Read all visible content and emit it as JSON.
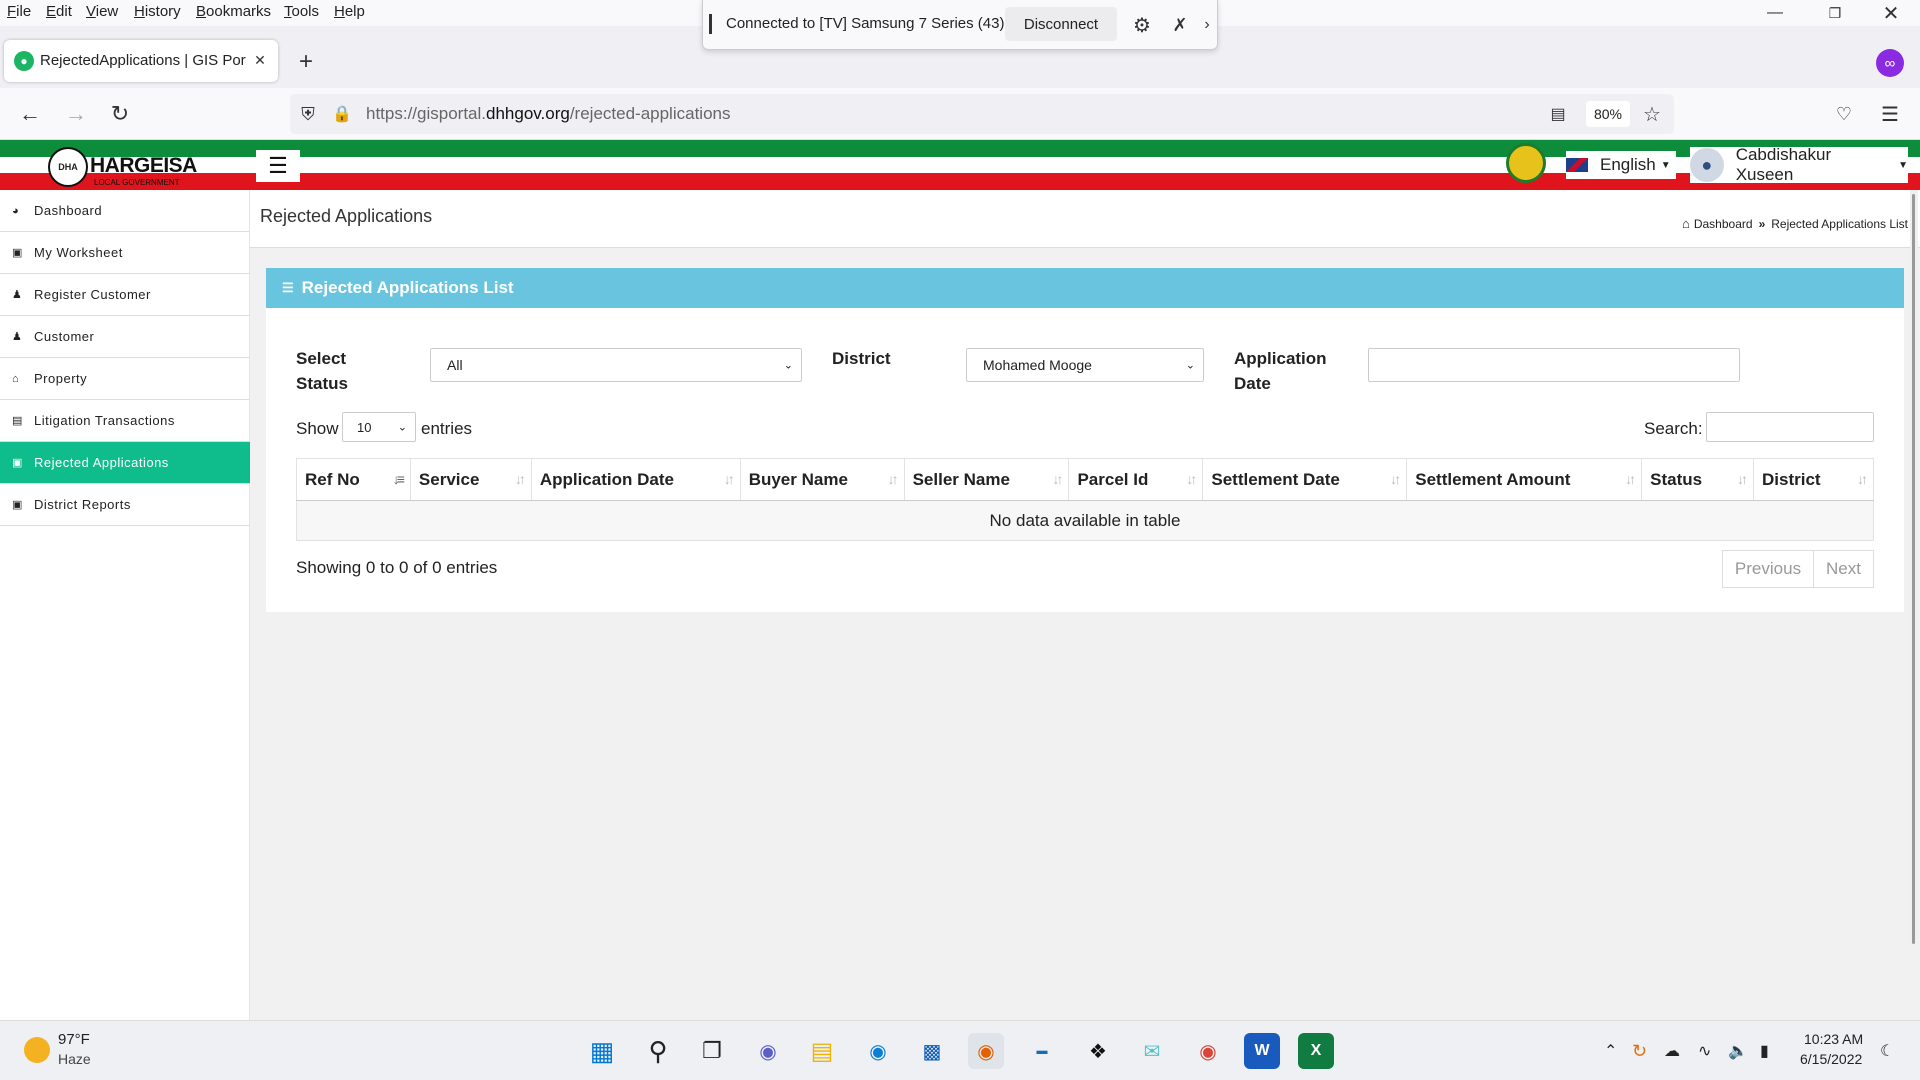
{
  "menubar": {
    "items": [
      "File",
      "Edit",
      "View",
      "History",
      "Bookmarks",
      "Tools",
      "Help"
    ]
  },
  "cast_bar": {
    "status": "Connected to [TV] Samsung 7 Series (43)",
    "disconnect_label": "Disconnect"
  },
  "browser_tab": {
    "title": "RejectedApplications | GIS Porta"
  },
  "urlbar": {
    "url_prefix": "https://gisportal.",
    "url_domain": "dhhgov.org",
    "url_path": "/rejected-applications",
    "zoom": "80%"
  },
  "app_header": {
    "logo_text": "HARGEISA",
    "logo_sub": "LOCAL GOVERNMENT",
    "logo_badge": "DHA",
    "language": "English",
    "user_name": "Cabdishakur Xuseen"
  },
  "sidebar": {
    "items": [
      {
        "label": "Dashboard",
        "icon": "dashboard-icon"
      },
      {
        "label": "My Worksheet",
        "icon": "book-icon"
      },
      {
        "label": "Register Customer",
        "icon": "user-icon"
      },
      {
        "label": "Customer",
        "icon": "user-icon"
      },
      {
        "label": "Property",
        "icon": "home-icon"
      },
      {
        "label": "Litigation Transactions",
        "icon": "credit-card-icon"
      },
      {
        "label": "Rejected Applications",
        "icon": "book-icon"
      },
      {
        "label": "District Reports",
        "icon": "book-icon"
      }
    ],
    "active_index": 6
  },
  "page": {
    "title": "Rejected Applications",
    "breadcrumb_home": "Dashboard",
    "breadcrumb_sep": "»",
    "breadcrumb_current": "Rejected Applications List"
  },
  "panel": {
    "heading": "Rejected Applications List",
    "filters": {
      "status_label_1": "Select",
      "status_label_2": "Status",
      "status_value": "All",
      "district_label": "District",
      "district_value": "Mohamed Mooge",
      "date_label_1": "Application",
      "date_label_2": "Date",
      "date_value": ""
    },
    "length": {
      "show_label": "Show",
      "value": "10",
      "entries_label": "entries"
    },
    "search_label": "Search:",
    "columns": [
      "Ref No",
      "Service",
      "Application Date",
      "Buyer Name",
      "Seller Name",
      "Parcel Id",
      "Settlement Date",
      "Settlement Amount",
      "Status",
      "District"
    ],
    "empty_message": "No data available in table",
    "info": "Showing 0 to 0 of 0 entries",
    "prev_label": "Previous",
    "next_label": "Next"
  },
  "taskbar": {
    "weather_temp": "97°F",
    "weather_desc": "Haze",
    "time": "10:23 AM",
    "date": "6/15/2022"
  },
  "colors": {
    "accent": "#0fbd8c",
    "panel_header": "#69c4df",
    "flag_green": "#0d8c3c",
    "flag_red": "#e0141c"
  }
}
